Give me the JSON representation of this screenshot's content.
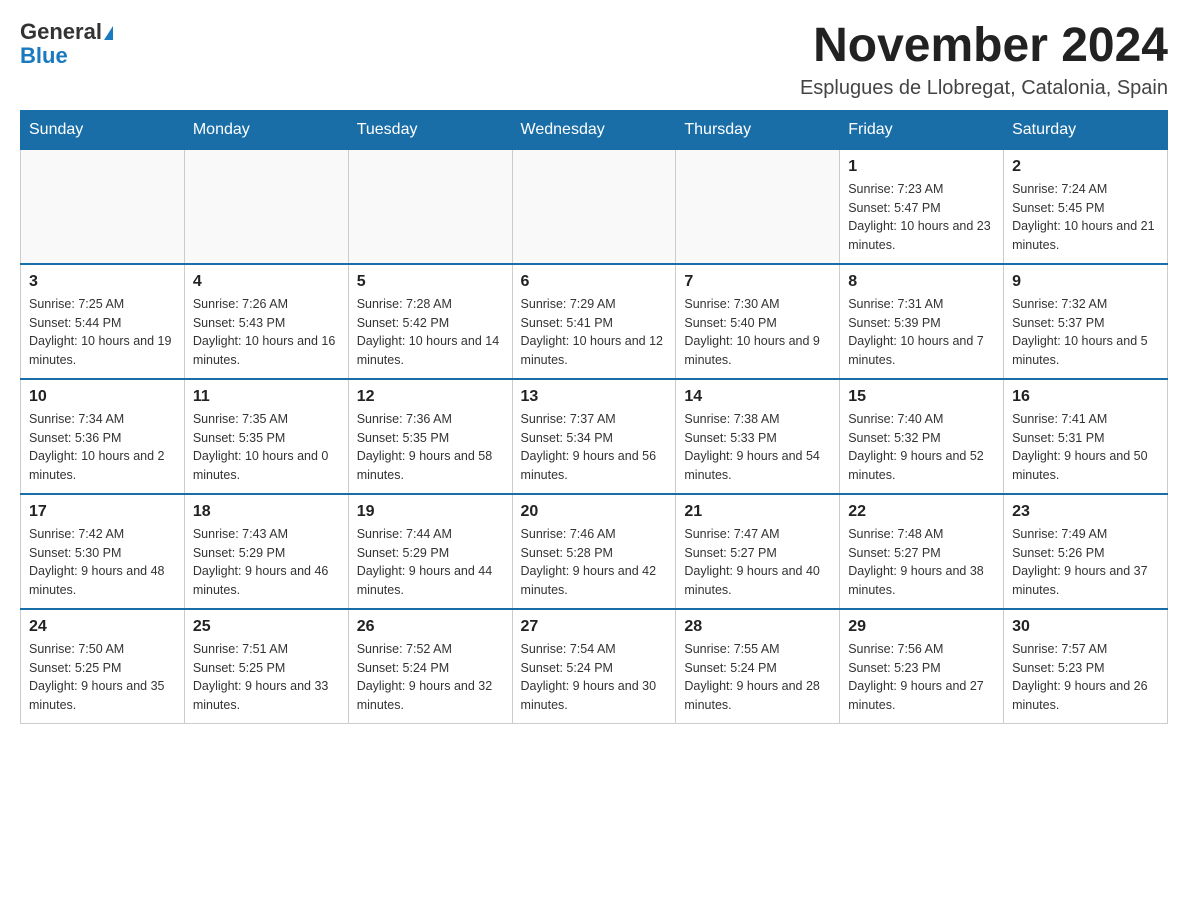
{
  "logo": {
    "text_general": "General",
    "text_blue": "Blue"
  },
  "header": {
    "month_year": "November 2024",
    "location": "Esplugues de Llobregat, Catalonia, Spain"
  },
  "days_of_week": [
    "Sunday",
    "Monday",
    "Tuesday",
    "Wednesday",
    "Thursday",
    "Friday",
    "Saturday"
  ],
  "weeks": [
    {
      "days": [
        {
          "number": "",
          "info": ""
        },
        {
          "number": "",
          "info": ""
        },
        {
          "number": "",
          "info": ""
        },
        {
          "number": "",
          "info": ""
        },
        {
          "number": "",
          "info": ""
        },
        {
          "number": "1",
          "info": "Sunrise: 7:23 AM\nSunset: 5:47 PM\nDaylight: 10 hours and 23 minutes."
        },
        {
          "number": "2",
          "info": "Sunrise: 7:24 AM\nSunset: 5:45 PM\nDaylight: 10 hours and 21 minutes."
        }
      ]
    },
    {
      "days": [
        {
          "number": "3",
          "info": "Sunrise: 7:25 AM\nSunset: 5:44 PM\nDaylight: 10 hours and 19 minutes."
        },
        {
          "number": "4",
          "info": "Sunrise: 7:26 AM\nSunset: 5:43 PM\nDaylight: 10 hours and 16 minutes."
        },
        {
          "number": "5",
          "info": "Sunrise: 7:28 AM\nSunset: 5:42 PM\nDaylight: 10 hours and 14 minutes."
        },
        {
          "number": "6",
          "info": "Sunrise: 7:29 AM\nSunset: 5:41 PM\nDaylight: 10 hours and 12 minutes."
        },
        {
          "number": "7",
          "info": "Sunrise: 7:30 AM\nSunset: 5:40 PM\nDaylight: 10 hours and 9 minutes."
        },
        {
          "number": "8",
          "info": "Sunrise: 7:31 AM\nSunset: 5:39 PM\nDaylight: 10 hours and 7 minutes."
        },
        {
          "number": "9",
          "info": "Sunrise: 7:32 AM\nSunset: 5:37 PM\nDaylight: 10 hours and 5 minutes."
        }
      ]
    },
    {
      "days": [
        {
          "number": "10",
          "info": "Sunrise: 7:34 AM\nSunset: 5:36 PM\nDaylight: 10 hours and 2 minutes."
        },
        {
          "number": "11",
          "info": "Sunrise: 7:35 AM\nSunset: 5:35 PM\nDaylight: 10 hours and 0 minutes."
        },
        {
          "number": "12",
          "info": "Sunrise: 7:36 AM\nSunset: 5:35 PM\nDaylight: 9 hours and 58 minutes."
        },
        {
          "number": "13",
          "info": "Sunrise: 7:37 AM\nSunset: 5:34 PM\nDaylight: 9 hours and 56 minutes."
        },
        {
          "number": "14",
          "info": "Sunrise: 7:38 AM\nSunset: 5:33 PM\nDaylight: 9 hours and 54 minutes."
        },
        {
          "number": "15",
          "info": "Sunrise: 7:40 AM\nSunset: 5:32 PM\nDaylight: 9 hours and 52 minutes."
        },
        {
          "number": "16",
          "info": "Sunrise: 7:41 AM\nSunset: 5:31 PM\nDaylight: 9 hours and 50 minutes."
        }
      ]
    },
    {
      "days": [
        {
          "number": "17",
          "info": "Sunrise: 7:42 AM\nSunset: 5:30 PM\nDaylight: 9 hours and 48 minutes."
        },
        {
          "number": "18",
          "info": "Sunrise: 7:43 AM\nSunset: 5:29 PM\nDaylight: 9 hours and 46 minutes."
        },
        {
          "number": "19",
          "info": "Sunrise: 7:44 AM\nSunset: 5:29 PM\nDaylight: 9 hours and 44 minutes."
        },
        {
          "number": "20",
          "info": "Sunrise: 7:46 AM\nSunset: 5:28 PM\nDaylight: 9 hours and 42 minutes."
        },
        {
          "number": "21",
          "info": "Sunrise: 7:47 AM\nSunset: 5:27 PM\nDaylight: 9 hours and 40 minutes."
        },
        {
          "number": "22",
          "info": "Sunrise: 7:48 AM\nSunset: 5:27 PM\nDaylight: 9 hours and 38 minutes."
        },
        {
          "number": "23",
          "info": "Sunrise: 7:49 AM\nSunset: 5:26 PM\nDaylight: 9 hours and 37 minutes."
        }
      ]
    },
    {
      "days": [
        {
          "number": "24",
          "info": "Sunrise: 7:50 AM\nSunset: 5:25 PM\nDaylight: 9 hours and 35 minutes."
        },
        {
          "number": "25",
          "info": "Sunrise: 7:51 AM\nSunset: 5:25 PM\nDaylight: 9 hours and 33 minutes."
        },
        {
          "number": "26",
          "info": "Sunrise: 7:52 AM\nSunset: 5:24 PM\nDaylight: 9 hours and 32 minutes."
        },
        {
          "number": "27",
          "info": "Sunrise: 7:54 AM\nSunset: 5:24 PM\nDaylight: 9 hours and 30 minutes."
        },
        {
          "number": "28",
          "info": "Sunrise: 7:55 AM\nSunset: 5:24 PM\nDaylight: 9 hours and 28 minutes."
        },
        {
          "number": "29",
          "info": "Sunrise: 7:56 AM\nSunset: 5:23 PM\nDaylight: 9 hours and 27 minutes."
        },
        {
          "number": "30",
          "info": "Sunrise: 7:57 AM\nSunset: 5:23 PM\nDaylight: 9 hours and 26 minutes."
        }
      ]
    }
  ]
}
